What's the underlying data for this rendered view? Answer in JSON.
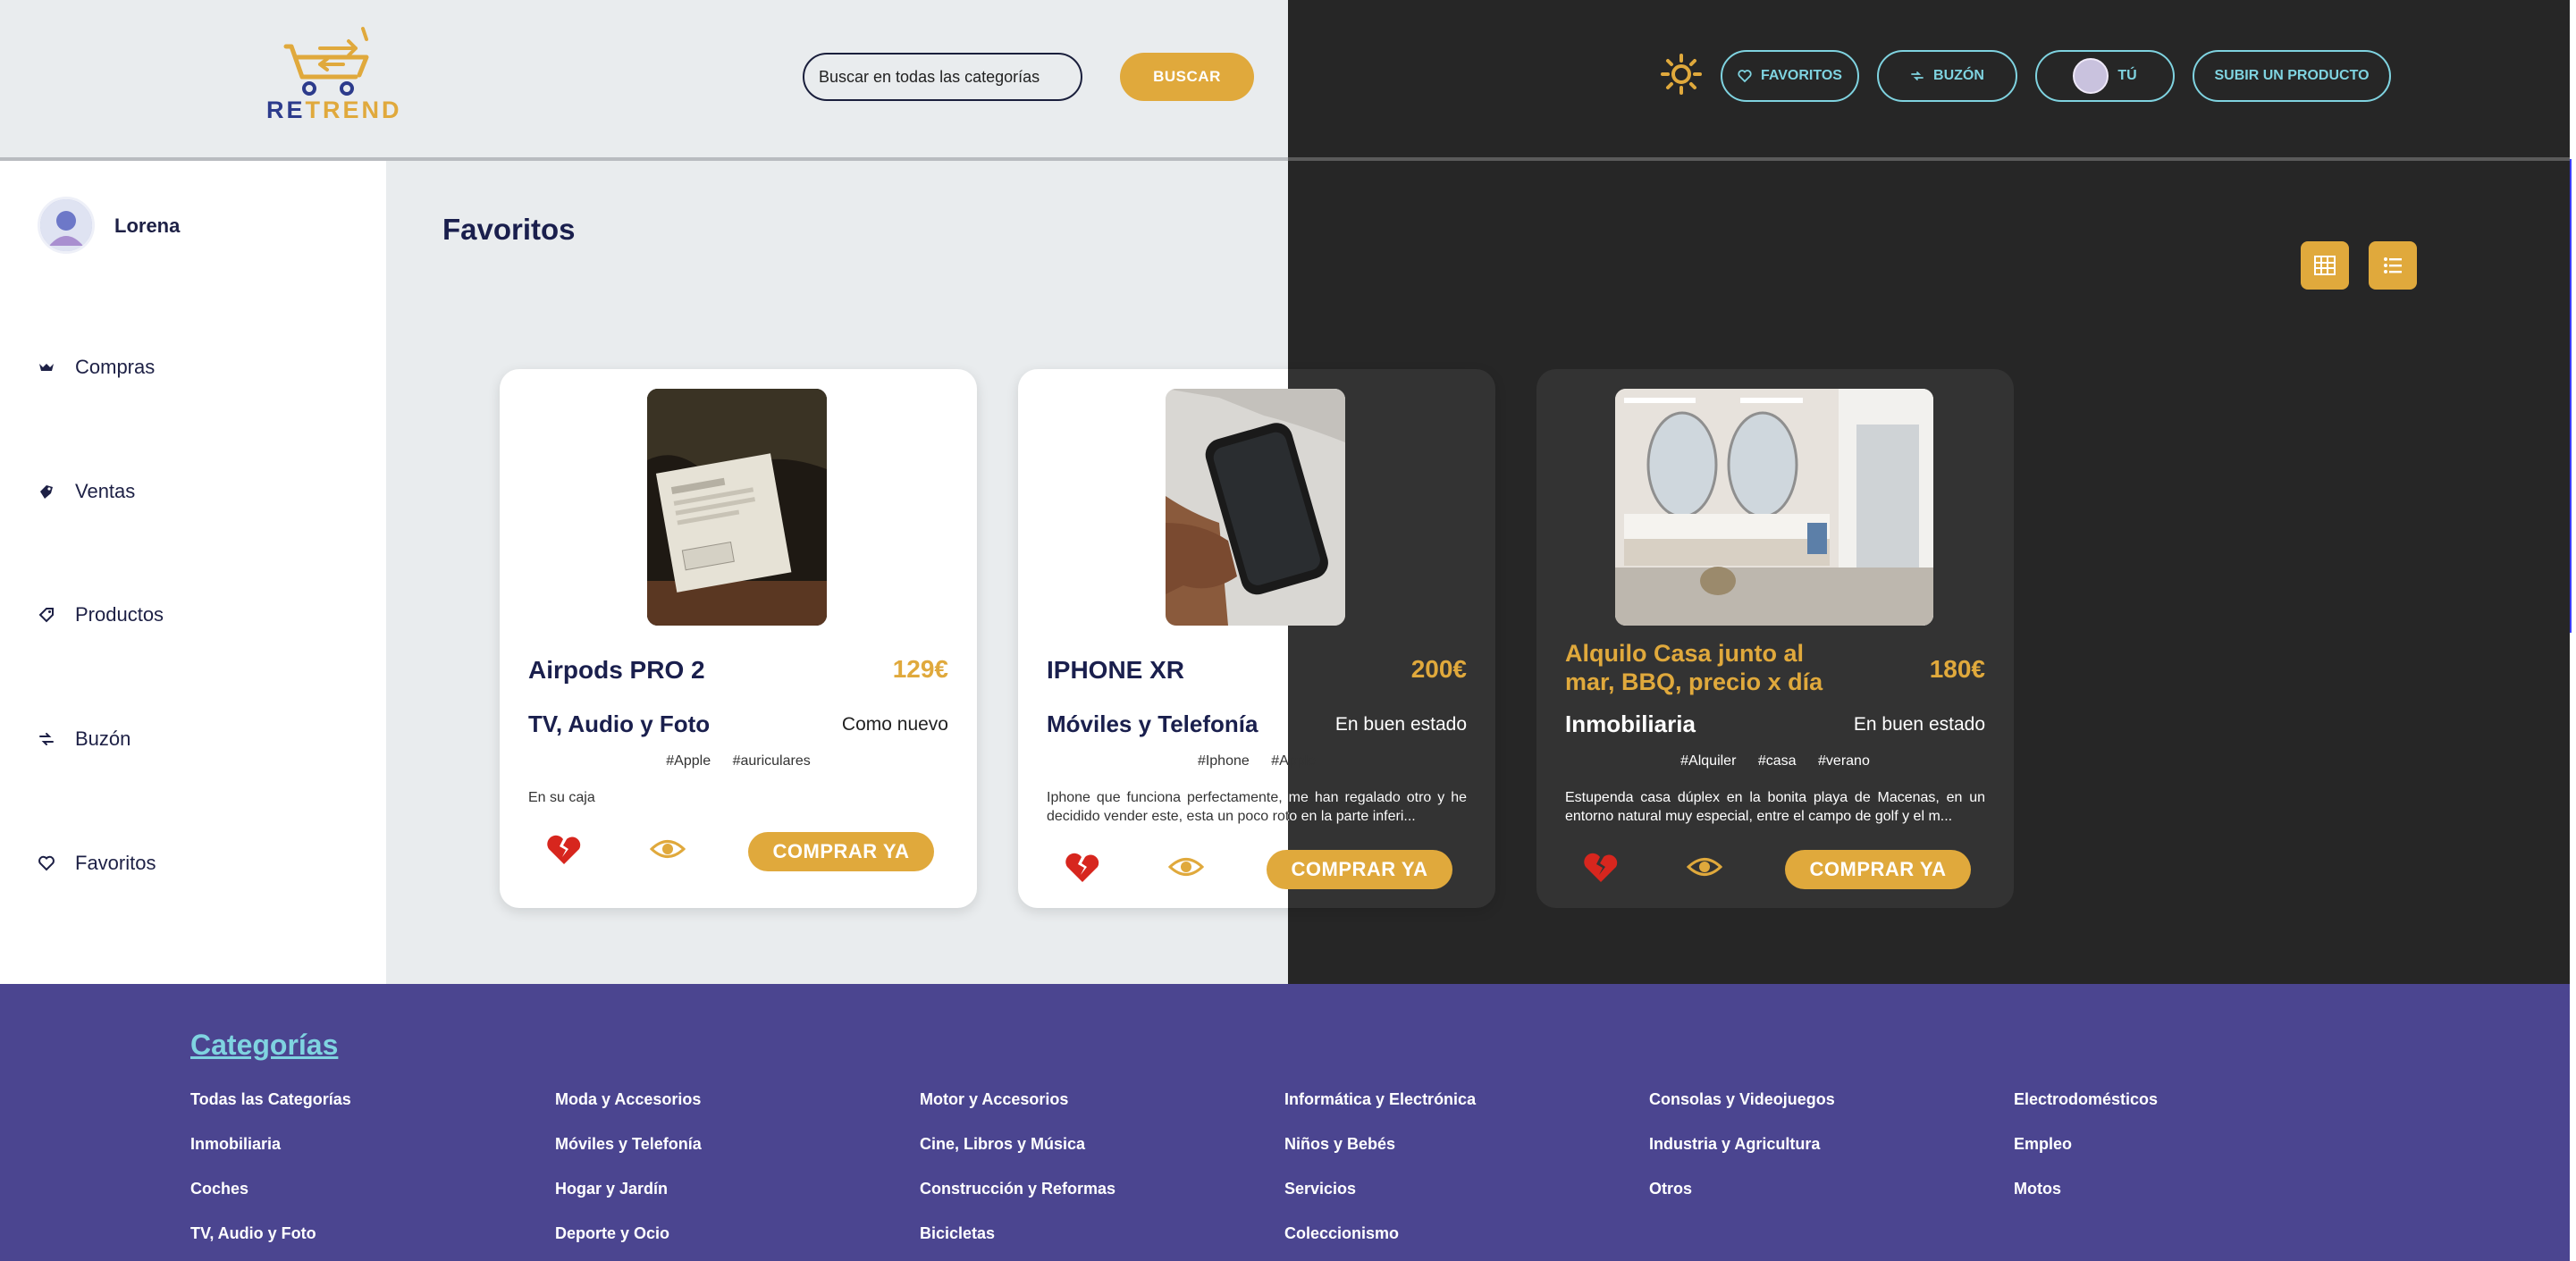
{
  "brand": {
    "re": "RE",
    "trend": "TREND"
  },
  "search": {
    "placeholder": "Buscar en todas las categorías",
    "button": "BUSCAR"
  },
  "nav": {
    "favorites": "FAVORITOS",
    "inbox": "BUZÓN",
    "you": "TÚ",
    "upload": "SUBIR UN PRODUCTO"
  },
  "user": {
    "name": "Lorena"
  },
  "sidebar": {
    "items": [
      {
        "label": "Compras",
        "icon": "shopping-icon"
      },
      {
        "label": "Ventas",
        "icon": "sales-icon"
      },
      {
        "label": "Productos",
        "icon": "tag-icon"
      },
      {
        "label": "Buzón",
        "icon": "inbox-icon"
      },
      {
        "label": "Favoritos",
        "icon": "heart-icon"
      }
    ]
  },
  "main": {
    "title": "Favoritos"
  },
  "products": [
    {
      "title": "Airpods PRO 2",
      "price": "129€",
      "category": "TV, Audio y Foto",
      "state": "Como nuevo",
      "tags": [
        "#Apple",
        "#auriculares"
      ],
      "description": "En su caja",
      "buy": "COMPRAR YA"
    },
    {
      "title": "IPHONE XR",
      "price": "200€",
      "category": "Móviles y Telefonía",
      "state": "En buen estado",
      "tags": [
        "#Iphone",
        "#Apple"
      ],
      "description": "Iphone que funciona perfectamente, me han regalado otro y he decidido vender este, esta un poco roto en la parte inferi...",
      "buy": "COMPRAR YA"
    },
    {
      "title": "Alquilo Casa junto al mar, BBQ, precio x día",
      "price": "180€",
      "category": "Inmobiliaria",
      "state": "En buen estado",
      "tags": [
        "#Alquiler",
        "#casa",
        "#verano"
      ],
      "description": "Estupenda casa dúplex en la bonita playa de Macenas, en un entorno natural muy especial, entre el campo de golf y el m...",
      "buy": "COMPRAR YA"
    }
  ],
  "footer": {
    "title": "Categorías",
    "columns": [
      [
        "Todas las Categorías",
        "Inmobiliaria",
        "Coches",
        "TV, Audio y Foto"
      ],
      [
        "Moda y Accesorios",
        "Móviles y Telefonía",
        "Hogar y Jardín",
        "Deporte y Ocio"
      ],
      [
        "Motor y Accesorios",
        "Cine, Libros y Música",
        "Construcción y Reformas",
        "Bicicletas"
      ],
      [
        "Informática y Electrónica",
        "Niños y Bebés",
        "Servicios",
        "Coleccionismo"
      ],
      [
        "Consolas y Videojuegos",
        "Industria y Agricultura",
        "Otros"
      ],
      [
        "Electrodomésticos",
        "Empleo",
        "Motos"
      ]
    ]
  },
  "colors": {
    "accent": "#e0a93c",
    "navy": "#1a1f4d",
    "cyan": "#7fd3e0",
    "footer": "#4b4590",
    "heart": "#d7261e"
  }
}
